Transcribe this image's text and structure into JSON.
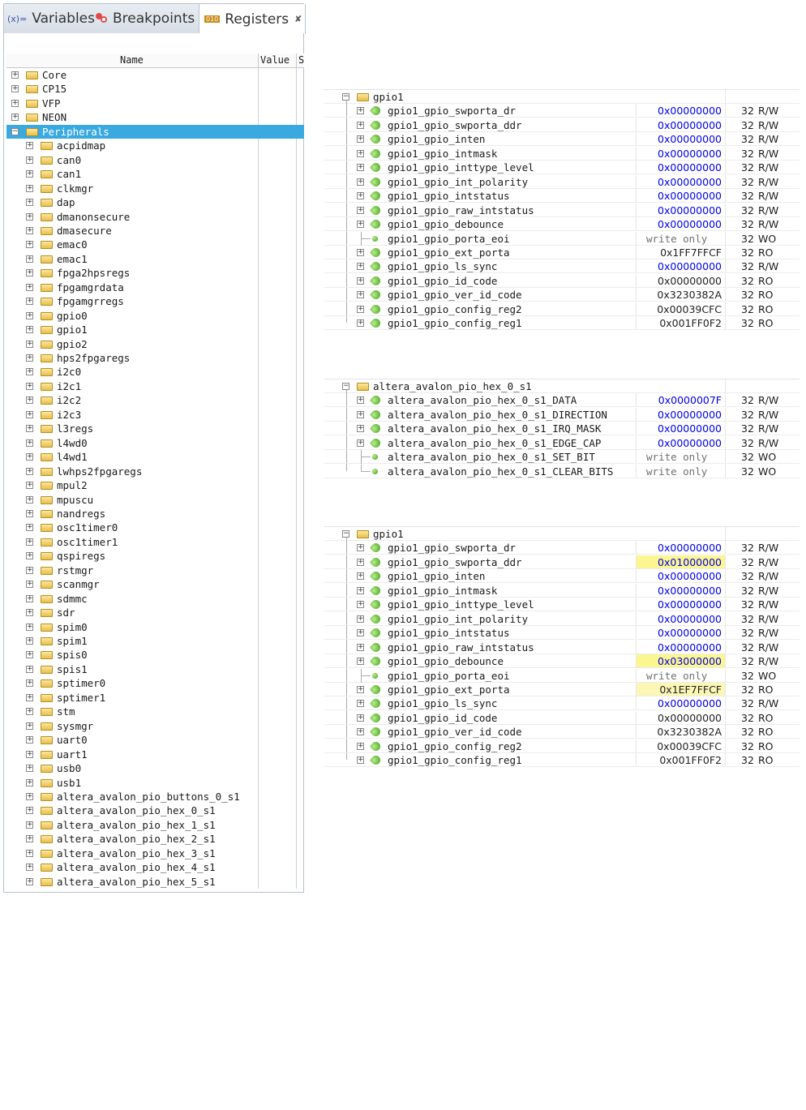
{
  "tabs": [
    {
      "label": "Variables",
      "icon": "variables-icon",
      "icon_text": "(x)="
    },
    {
      "label": "Breakpoints",
      "icon": "breakpoints-icon"
    },
    {
      "label": "Registers",
      "icon": "registers-icon",
      "icon_text": "010",
      "close": "✘"
    }
  ],
  "columns": {
    "name": "Name",
    "value": "Value",
    "s": "S"
  },
  "left_tree": [
    {
      "label": "Core",
      "level": 0
    },
    {
      "label": "CP15",
      "level": 0
    },
    {
      "label": "VFP",
      "level": 0
    },
    {
      "label": "NEON",
      "level": 0
    },
    {
      "label": "Peripherals",
      "level": 0,
      "expanded": true,
      "selected": true
    },
    {
      "label": "acpidmap",
      "level": 1
    },
    {
      "label": "can0",
      "level": 1
    },
    {
      "label": "can1",
      "level": 1
    },
    {
      "label": "clkmgr",
      "level": 1
    },
    {
      "label": "dap",
      "level": 1
    },
    {
      "label": "dmanonsecure",
      "level": 1
    },
    {
      "label": "dmasecure",
      "level": 1
    },
    {
      "label": "emac0",
      "level": 1
    },
    {
      "label": "emac1",
      "level": 1
    },
    {
      "label": "fpga2hpsregs",
      "level": 1
    },
    {
      "label": "fpgamgrdata",
      "level": 1
    },
    {
      "label": "fpgamgrregs",
      "level": 1
    },
    {
      "label": "gpio0",
      "level": 1
    },
    {
      "label": "gpio1",
      "level": 1
    },
    {
      "label": "gpio2",
      "level": 1
    },
    {
      "label": "hps2fpgaregs",
      "level": 1
    },
    {
      "label": "i2c0",
      "level": 1
    },
    {
      "label": "i2c1",
      "level": 1
    },
    {
      "label": "i2c2",
      "level": 1
    },
    {
      "label": "i2c3",
      "level": 1
    },
    {
      "label": "l3regs",
      "level": 1
    },
    {
      "label": "l4wd0",
      "level": 1
    },
    {
      "label": "l4wd1",
      "level": 1
    },
    {
      "label": "lwhps2fpgaregs",
      "level": 1
    },
    {
      "label": "mpul2",
      "level": 1
    },
    {
      "label": "mpuscu",
      "level": 1
    },
    {
      "label": "nandregs",
      "level": 1
    },
    {
      "label": "osc1timer0",
      "level": 1
    },
    {
      "label": "osc1timer1",
      "level": 1
    },
    {
      "label": "qspiregs",
      "level": 1
    },
    {
      "label": "rstmgr",
      "level": 1
    },
    {
      "label": "scanmgr",
      "level": 1
    },
    {
      "label": "sdmmc",
      "level": 1
    },
    {
      "label": "sdr",
      "level": 1
    },
    {
      "label": "spim0",
      "level": 1
    },
    {
      "label": "spim1",
      "level": 1
    },
    {
      "label": "spis0",
      "level": 1
    },
    {
      "label": "spis1",
      "level": 1
    },
    {
      "label": "sptimer0",
      "level": 1
    },
    {
      "label": "sptimer1",
      "level": 1
    },
    {
      "label": "stm",
      "level": 1
    },
    {
      "label": "sysmgr",
      "level": 1
    },
    {
      "label": "uart0",
      "level": 1
    },
    {
      "label": "uart1",
      "level": 1
    },
    {
      "label": "usb0",
      "level": 1
    },
    {
      "label": "usb1",
      "level": 1
    },
    {
      "label": "altera_avalon_pio_buttons_0_s1",
      "level": 1
    },
    {
      "label": "altera_avalon_pio_hex_0_s1",
      "level": 1
    },
    {
      "label": "altera_avalon_pio_hex_1_s1",
      "level": 1
    },
    {
      "label": "altera_avalon_pio_hex_2_s1",
      "level": 1
    },
    {
      "label": "altera_avalon_pio_hex_3_s1",
      "level": 1
    },
    {
      "label": "altera_avalon_pio_hex_4_s1",
      "level": 1
    },
    {
      "label": "altera_avalon_pio_hex_5_s1",
      "level": 1
    }
  ],
  "panels": [
    {
      "group": "gpio1",
      "rows": [
        {
          "name": "gpio1_gpio_swporta_dr",
          "value": "0x00000000",
          "size": "32",
          "access": "R/W",
          "style": "blue"
        },
        {
          "name": "gpio1_gpio_swporta_ddr",
          "value": "0x00000000",
          "size": "32",
          "access": "R/W",
          "style": "blue"
        },
        {
          "name": "gpio1_gpio_inten",
          "value": "0x00000000",
          "size": "32",
          "access": "R/W",
          "style": "blue"
        },
        {
          "name": "gpio1_gpio_intmask",
          "value": "0x00000000",
          "size": "32",
          "access": "R/W",
          "style": "blue"
        },
        {
          "name": "gpio1_gpio_inttype_level",
          "value": "0x00000000",
          "size": "32",
          "access": "R/W",
          "style": "blue"
        },
        {
          "name": "gpio1_gpio_int_polarity",
          "value": "0x00000000",
          "size": "32",
          "access": "R/W",
          "style": "blue"
        },
        {
          "name": "gpio1_gpio_intstatus",
          "value": "0x00000000",
          "size": "32",
          "access": "R/W",
          "style": "blue"
        },
        {
          "name": "gpio1_gpio_raw_intstatus",
          "value": "0x00000000",
          "size": "32",
          "access": "R/W",
          "style": "blue"
        },
        {
          "name": "gpio1_gpio_debounce",
          "value": "0x00000000",
          "size": "32",
          "access": "R/W",
          "style": "blue"
        },
        {
          "name": "gpio1_gpio_porta_eoi",
          "value": "write only",
          "size": "32",
          "access": "WO",
          "style": "gray",
          "leaf": true
        },
        {
          "name": "gpio1_gpio_ext_porta",
          "value": "0x1FF7FFCF",
          "size": "32",
          "access": "RO",
          "style": "black"
        },
        {
          "name": "gpio1_gpio_ls_sync",
          "value": "0x00000000",
          "size": "32",
          "access": "R/W",
          "style": "blue"
        },
        {
          "name": "gpio1_gpio_id_code",
          "value": "0x00000000",
          "size": "32",
          "access": "RO",
          "style": "black"
        },
        {
          "name": "gpio1_gpio_ver_id_code",
          "value": "0x3230382A",
          "size": "32",
          "access": "RO",
          "style": "black"
        },
        {
          "name": "gpio1_gpio_config_reg2",
          "value": "0x00039CFC",
          "size": "32",
          "access": "RO",
          "style": "black"
        },
        {
          "name": "gpio1_gpio_config_reg1",
          "value": "0x001FF0F2",
          "size": "32",
          "access": "RO",
          "style": "black"
        }
      ]
    },
    {
      "group": "altera_avalon_pio_hex_0_s1",
      "rows": [
        {
          "name": "altera_avalon_pio_hex_0_s1_DATA",
          "value": "0x0000007F",
          "size": "32",
          "access": "R/W",
          "style": "blue"
        },
        {
          "name": "altera_avalon_pio_hex_0_s1_DIRECTION",
          "value": "0x00000000",
          "size": "32",
          "access": "R/W",
          "style": "blue"
        },
        {
          "name": "altera_avalon_pio_hex_0_s1_IRQ_MASK",
          "value": "0x00000000",
          "size": "32",
          "access": "R/W",
          "style": "blue"
        },
        {
          "name": "altera_avalon_pio_hex_0_s1_EDGE_CAP",
          "value": "0x00000000",
          "size": "32",
          "access": "R/W",
          "style": "blue"
        },
        {
          "name": "altera_avalon_pio_hex_0_s1_SET_BIT",
          "value": "write only",
          "size": "32",
          "access": "WO",
          "style": "gray",
          "leaf": true
        },
        {
          "name": "altera_avalon_pio_hex_0_s1_CLEAR_BITS",
          "value": "write only",
          "size": "32",
          "access": "WO",
          "style": "gray",
          "leaf": true,
          "last": true
        }
      ]
    },
    {
      "group": "gpio1",
      "rows": [
        {
          "name": "gpio1_gpio_swporta_dr",
          "value": "0x00000000",
          "size": "32",
          "access": "R/W",
          "style": "blue"
        },
        {
          "name": "gpio1_gpio_swporta_ddr",
          "value": "0x01000000",
          "size": "32",
          "access": "R/W",
          "style": "blue",
          "highlight": "#fbf690"
        },
        {
          "name": "gpio1_gpio_inten",
          "value": "0x00000000",
          "size": "32",
          "access": "R/W",
          "style": "blue"
        },
        {
          "name": "gpio1_gpio_intmask",
          "value": "0x00000000",
          "size": "32",
          "access": "R/W",
          "style": "blue"
        },
        {
          "name": "gpio1_gpio_inttype_level",
          "value": "0x00000000",
          "size": "32",
          "access": "R/W",
          "style": "blue"
        },
        {
          "name": "gpio1_gpio_int_polarity",
          "value": "0x00000000",
          "size": "32",
          "access": "R/W",
          "style": "blue"
        },
        {
          "name": "gpio1_gpio_intstatus",
          "value": "0x00000000",
          "size": "32",
          "access": "R/W",
          "style": "blue"
        },
        {
          "name": "gpio1_gpio_raw_intstatus",
          "value": "0x00000000",
          "size": "32",
          "access": "R/W",
          "style": "blue"
        },
        {
          "name": "gpio1_gpio_debounce",
          "value": "0x03000000",
          "size": "32",
          "access": "R/W",
          "style": "blue",
          "highlight": "#fbf690"
        },
        {
          "name": "gpio1_gpio_porta_eoi",
          "value": "write only",
          "size": "32",
          "access": "WO",
          "style": "gray",
          "leaf": true
        },
        {
          "name": "gpio1_gpio_ext_porta",
          "value": "0x1EF7FFCF",
          "size": "32",
          "access": "RO",
          "style": "black",
          "highlight": "#fcf7b5"
        },
        {
          "name": "gpio1_gpio_ls_sync",
          "value": "0x00000000",
          "size": "32",
          "access": "R/W",
          "style": "blue"
        },
        {
          "name": "gpio1_gpio_id_code",
          "value": "0x00000000",
          "size": "32",
          "access": "RO",
          "style": "black"
        },
        {
          "name": "gpio1_gpio_ver_id_code",
          "value": "0x3230382A",
          "size": "32",
          "access": "RO",
          "style": "black"
        },
        {
          "name": "gpio1_gpio_config_reg2",
          "value": "0x00039CFC",
          "size": "32",
          "access": "RO",
          "style": "black"
        },
        {
          "name": "gpio1_gpio_config_reg1",
          "value": "0x001FF0F2",
          "size": "32",
          "access": "RO",
          "style": "black"
        }
      ]
    }
  ],
  "colors": {
    "selection": "#3aa9e0",
    "value_blue": "#0000e6",
    "changed_highlight": "#fbf690"
  }
}
